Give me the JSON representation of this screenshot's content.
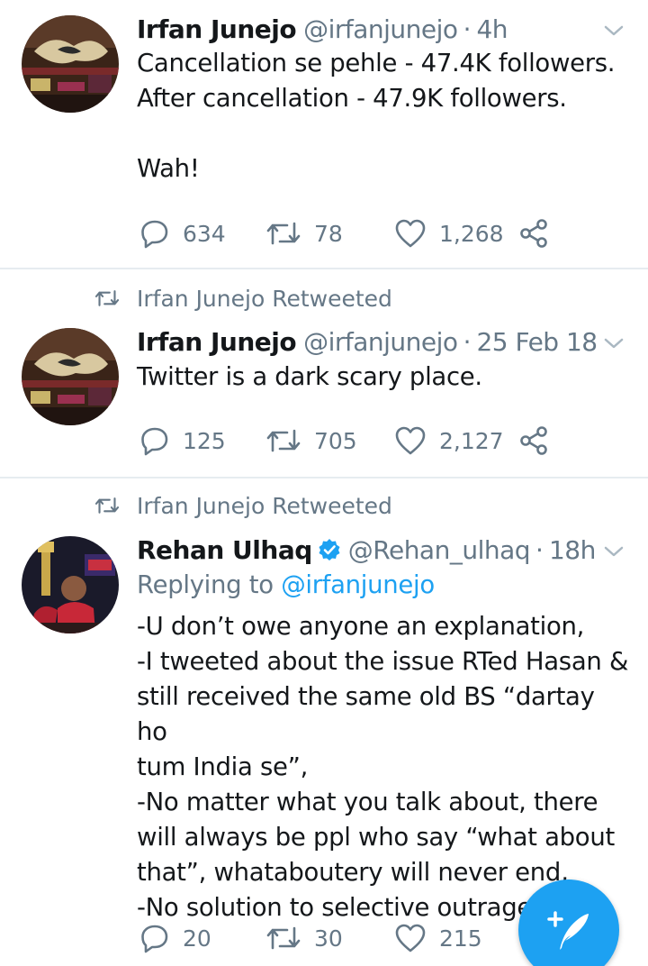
{
  "tweets": [
    {
      "name": "Irfan Junejo",
      "handle": "@irfanjunejo",
      "time": "4h",
      "lines": [
        "Cancellation se pehle - 47.4K followers.",
        "After cancellation - 47.9K followers.",
        "",
        "Wah!"
      ],
      "replies": "634",
      "retweets": "78",
      "likes": "1,268"
    },
    {
      "retweeted_by": "Irfan Junejo Retweeted",
      "name": "Irfan Junejo",
      "handle": "@irfanjunejo",
      "time": "25 Feb 18",
      "lines": [
        "Twitter is a dark scary place."
      ],
      "replies": "125",
      "retweets": "705",
      "likes": "2,127"
    },
    {
      "retweeted_by": "Irfan Junejo Retweeted",
      "name": "Rehan Ulhaq",
      "handle": "@Rehan_ulhaq",
      "time": "18h",
      "verified": true,
      "replying_label": "Replying to",
      "replying_to": "@irfanjunejo",
      "lines": [
        "-U don’t owe anyone an explanation,",
        "-I tweeted about the issue RTed Hasan &",
        "still received the same old BS “dartay ho",
        "tum India se”,",
        "-No matter what you talk about, there",
        "will always be ppl who say “what about",
        "that”, whataboutery will never end,",
        "-No solution to selective outrage"
      ],
      "replies": "20",
      "retweets": "30",
      "likes": "215"
    }
  ],
  "dot": "·",
  "icons": {
    "reply": "reply-icon",
    "retweet": "retweet-icon",
    "like": "heart-icon",
    "share": "share-icon",
    "menu": "chevron-down-icon",
    "verified": "verified-badge-icon",
    "compose": "compose-tweet-icon"
  },
  "colors": {
    "accent": "#1da1f2",
    "secondary_text": "#657786",
    "primary_text": "#14171a",
    "divider": "#e6ecf0"
  }
}
